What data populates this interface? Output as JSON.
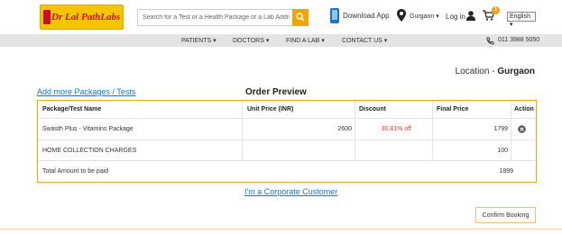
{
  "header": {
    "logo_text": "Dr Lal PathLabs",
    "search_placeholder": "Search for a Test or a Health Package or a Lab Address",
    "download_label": "Download App",
    "location_label": "Gurgaon",
    "login_label": "Log in",
    "cart_count": "1",
    "language": "English"
  },
  "nav": {
    "items": [
      "PATIENTS",
      "DOCTORS",
      "FIND A LAB",
      "CONTACT US"
    ],
    "phone": "011 3988 5050"
  },
  "location": {
    "prefix": "Location - ",
    "city": "Gurgaon"
  },
  "add_more_link": "Add more Packages / Tests",
  "order_title": "Order Preview",
  "table": {
    "headers": [
      "Package/Test Name",
      "Unit Price (INR)",
      "Discount",
      "Final Price",
      "Action"
    ],
    "item": {
      "name": "Swasth Plus - Vitamins Package",
      "unit_price": "2600",
      "discount": "30.81% off",
      "final_price": "1799"
    },
    "home_collection": {
      "label": "HOME COLLECTION CHARGES",
      "amount": "100"
    },
    "total": {
      "label": "Total Amount to be paid",
      "amount": "1899"
    }
  },
  "corporate_link": "I'm a Corporate Customer",
  "confirm_button": "Confirm Booking",
  "colors": {
    "accent": "#f0a500",
    "link": "#1a73c8",
    "discount": "#e53935",
    "logo_bg": "#f5c400"
  }
}
